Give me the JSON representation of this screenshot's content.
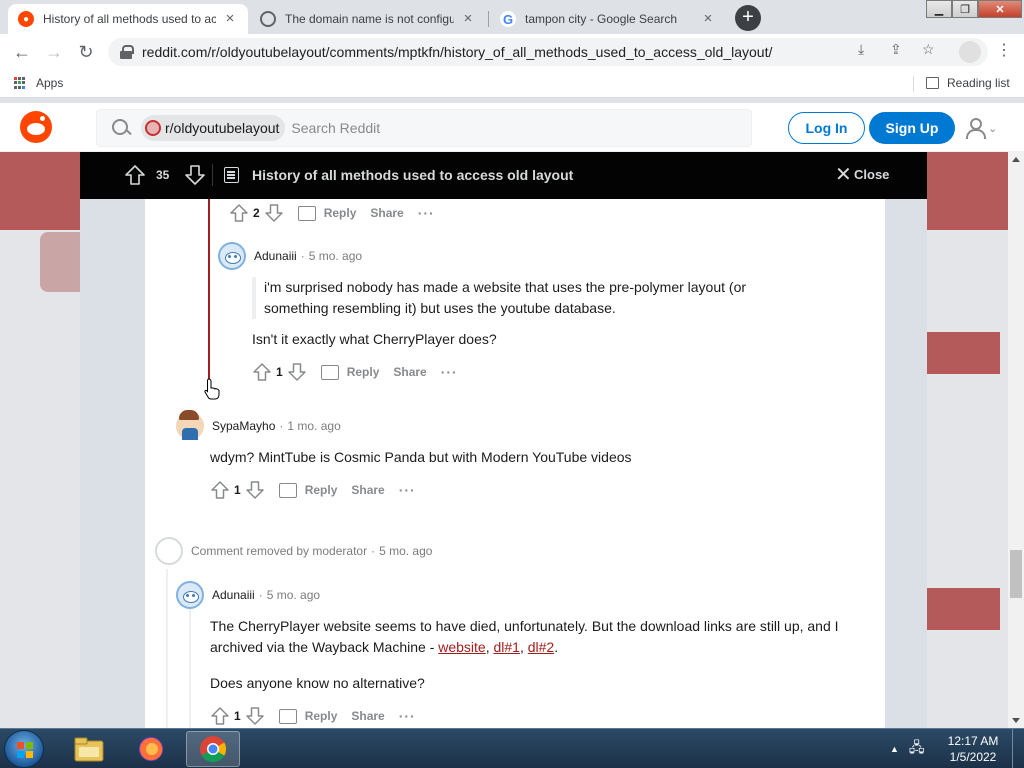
{
  "browser": {
    "tabs": [
      {
        "title": "History of all methods used to access old layout",
        "favicon": "reddit-icon",
        "active": true
      },
      {
        "title": "The domain name is not configured",
        "favicon": "globe-icon",
        "active": false
      },
      {
        "title": "tampon city - Google Search",
        "favicon": "google-icon",
        "active": false
      }
    ],
    "url": "reddit.com/r/oldyoutubelayout/comments/mptkfn/history_of_all_methods_used_to_access_old_layout/",
    "bookmarks": {
      "apps_label": "Apps",
      "reading_list_label": "Reading list"
    }
  },
  "reddit": {
    "header": {
      "subreddit_chip": "r/oldyoutubelayout",
      "search_placeholder": "Search Reddit",
      "login_label": "Log In",
      "signup_label": "Sign Up"
    },
    "post_bar": {
      "score": "35",
      "title": "History of all methods used to access old layout",
      "close_label": "Close"
    },
    "top_actions": {
      "score": "2",
      "reply_label": "Reply",
      "share_label": "Share",
      "more_label": "···"
    },
    "comments": [
      {
        "author": "Adunaiii",
        "age": "5 mo. ago",
        "quote": "i'm surprised nobody has made a website that uses the pre-polymer layout (or something resembling it) but uses the youtube database.",
        "text": "Isn't it exactly what CherryPlayer does?",
        "score": "1",
        "reply_label": "Reply",
        "share_label": "Share",
        "more_label": "···"
      },
      {
        "author": "SypaMayho",
        "age": "1 mo. ago",
        "text": "wdym? MintTube is Cosmic Panda but with Modern YouTube videos",
        "score": "1",
        "reply_label": "Reply",
        "share_label": "Share",
        "more_label": "···"
      },
      {
        "removed_text": "Comment removed by moderator",
        "age": "5 mo. ago"
      },
      {
        "author": "Adunaiii",
        "age": "5 mo. ago",
        "text_part1": "The CherryPlayer website seems to have died, unfortunately. But the download links are still up, and I archived via the Wayback Machine - ",
        "link1": "website",
        "sep1": ", ",
        "link2": "dl#1",
        "sep2": ", ",
        "link3": "dl#2",
        "text_end": ".",
        "text2": "Does anyone know no alternative?",
        "score": "1",
        "reply_label": "Reply",
        "share_label": "Share",
        "more_label": "···"
      }
    ]
  },
  "taskbar": {
    "apps": [
      "windows-explorer-icon",
      "firefox-icon",
      "chrome-icon"
    ],
    "clock_time": "12:17 AM",
    "clock_date": "1/5/2022"
  },
  "colors": {
    "reddit_orange": "#ff4500",
    "reddit_blue": "#0079d3",
    "thread_active": "#a41d1d",
    "link": "#a41d1d"
  }
}
